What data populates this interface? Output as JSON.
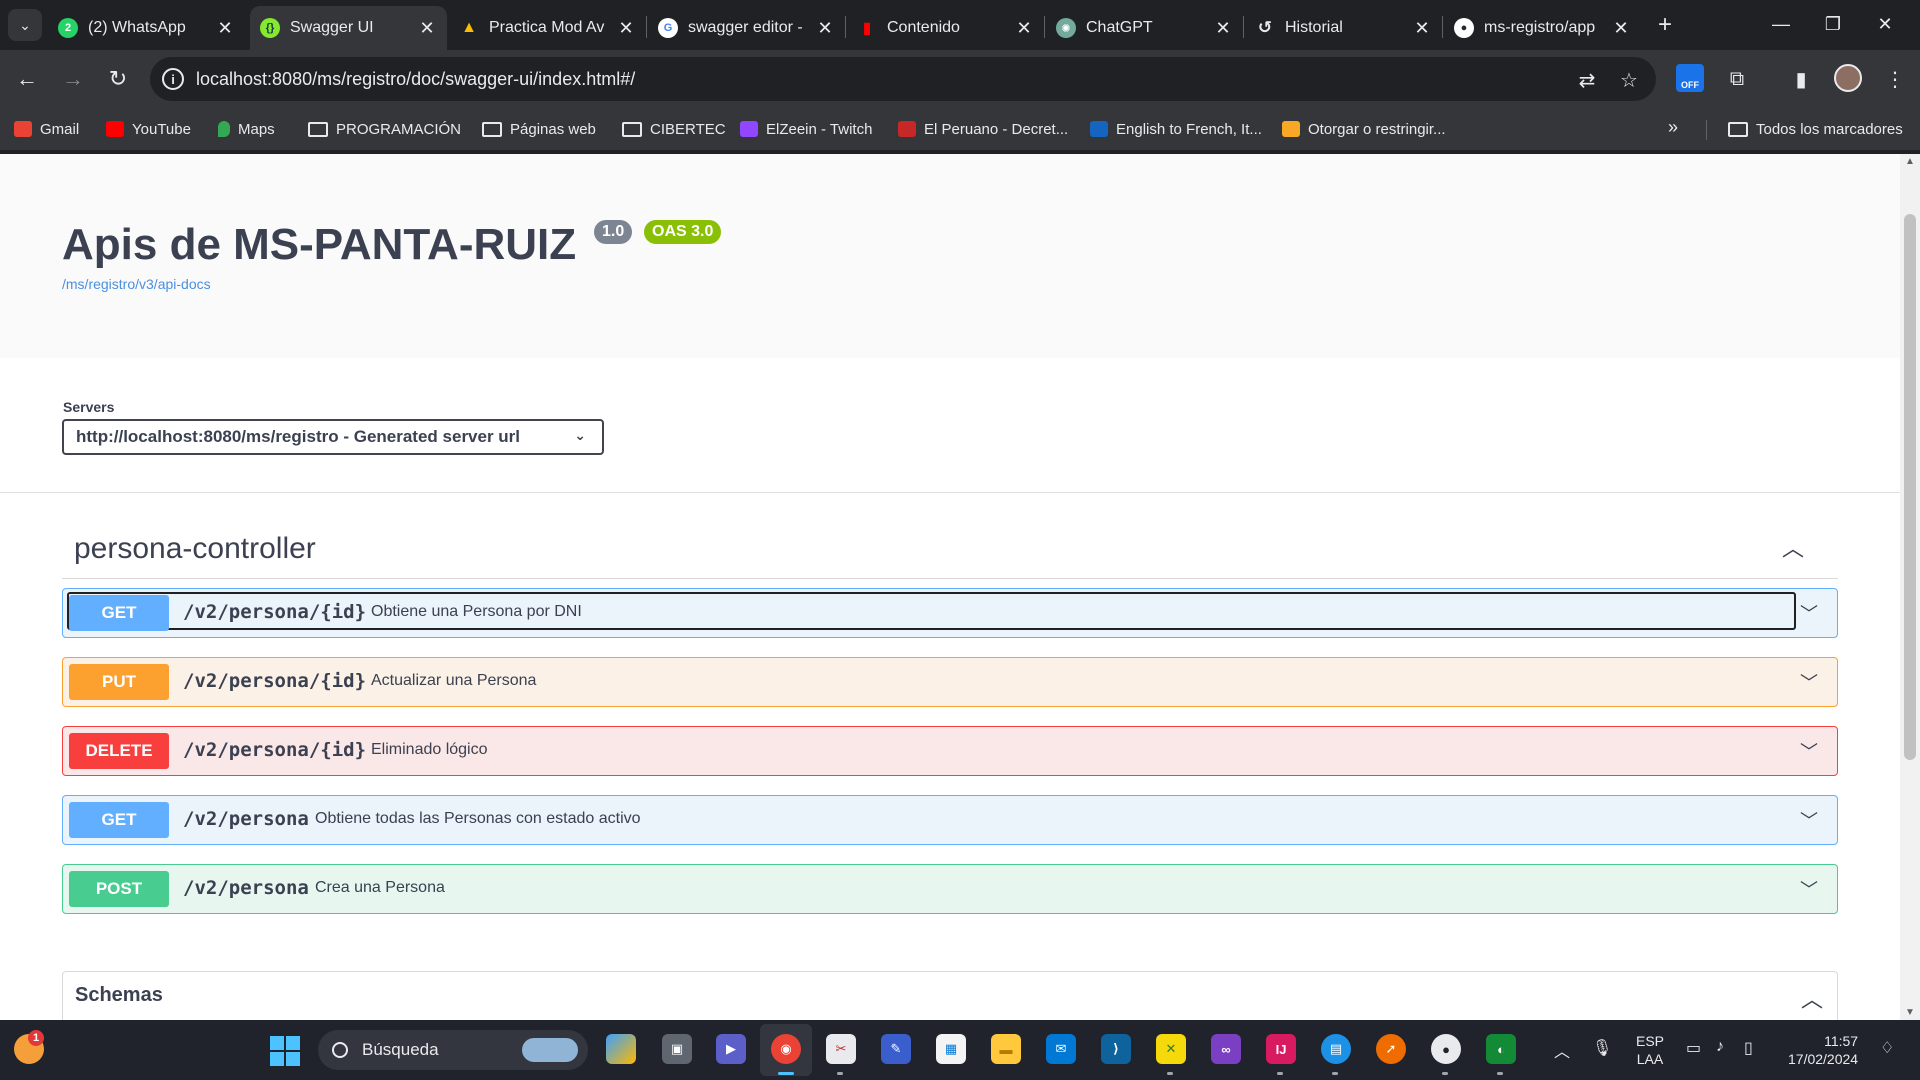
{
  "browser": {
    "tabs": [
      {
        "label": "(2) WhatsApp",
        "icon": "whatsapp-icon",
        "color": "#25d366",
        "glyph": "2"
      },
      {
        "label": "Swagger UI",
        "icon": "swagger-icon",
        "color": "#85ea2d",
        "glyph": "{}"
      },
      {
        "label": "Practica Mod Av",
        "icon": "google-drive-icon",
        "color": "#fbbc04",
        "glyph": "▲"
      },
      {
        "label": "swagger editor -",
        "icon": "google-icon",
        "color": "#ffffff",
        "glyph": "G"
      },
      {
        "label": "Contenido",
        "icon": "analytics-icon",
        "color": "#ff0000",
        "glyph": "▮"
      },
      {
        "label": "ChatGPT",
        "icon": "chatgpt-icon",
        "color": "#74aa9c",
        "glyph": "✺"
      },
      {
        "label": "Historial",
        "icon": "history-icon",
        "color": "#35363a",
        "glyph": "↺"
      },
      {
        "label": "ms-registro/app",
        "icon": "github-icon",
        "color": "#ffffff",
        "glyph": "●"
      }
    ],
    "url": "localhost:8080/ms/registro/doc/swagger-ui/index.html#/",
    "bookmarks": [
      {
        "label": "Gmail",
        "type": "site",
        "color": "#ea4335"
      },
      {
        "label": "YouTube",
        "type": "site",
        "color": "#ff0000"
      },
      {
        "label": "Maps",
        "type": "site",
        "color": "#34a853"
      },
      {
        "label": "PROGRAMACIÓN",
        "type": "folder"
      },
      {
        "label": "Páginas web",
        "type": "folder"
      },
      {
        "label": "CIBERTEC",
        "type": "folder"
      },
      {
        "label": "ElZeein - Twitch",
        "type": "site",
        "color": "#9146ff"
      },
      {
        "label": "El Peruano - Decret...",
        "type": "site",
        "color": "#c62828"
      },
      {
        "label": "English to French, It...",
        "type": "site",
        "color": "#1565c0"
      },
      {
        "label": "Otorgar o restringir...",
        "type": "site",
        "color": "#f9a825"
      }
    ],
    "all_bookmarks": "Todos los marcadores",
    "extension_badge": "OFF"
  },
  "swagger": {
    "title": "Apis de MS-PANTA-RUIZ",
    "version_badge": "1.0",
    "oas_badge": "OAS 3.0",
    "spec_link": "/ms/registro/v3/api-docs",
    "servers_label": "Servers",
    "server_selected": "http://localhost:8080/ms/registro - Generated server url",
    "controller": "persona-controller",
    "operations": [
      {
        "method": "GET",
        "path": "/v2/persona/{id}",
        "summary": "Obtiene una Persona por DNI",
        "color": "#61affe",
        "bg": "#ebf3fb"
      },
      {
        "method": "PUT",
        "path": "/v2/persona/{id}",
        "summary": "Actualizar una Persona",
        "color": "#fca130",
        "bg": "#fbf1e6"
      },
      {
        "method": "DELETE",
        "path": "/v2/persona/{id}",
        "summary": "Eliminado lógico",
        "color": "#f93e3e",
        "bg": "#fae7e7"
      },
      {
        "method": "GET",
        "path": "/v2/persona",
        "summary": "Obtiene todas las Personas con estado activo",
        "color": "#61affe",
        "bg": "#ebf3fb"
      },
      {
        "method": "POST",
        "path": "/v2/persona",
        "summary": "Crea una Persona",
        "color": "#49cc90",
        "bg": "#e8f6f0"
      }
    ],
    "schemas_title": "Schemas"
  },
  "taskbar": {
    "weather_badge": "1",
    "search_placeholder": "Búsqueda",
    "lang_top": "ESP",
    "lang_bottom": "LAA",
    "time": "11:57",
    "date": "17/02/2024"
  }
}
